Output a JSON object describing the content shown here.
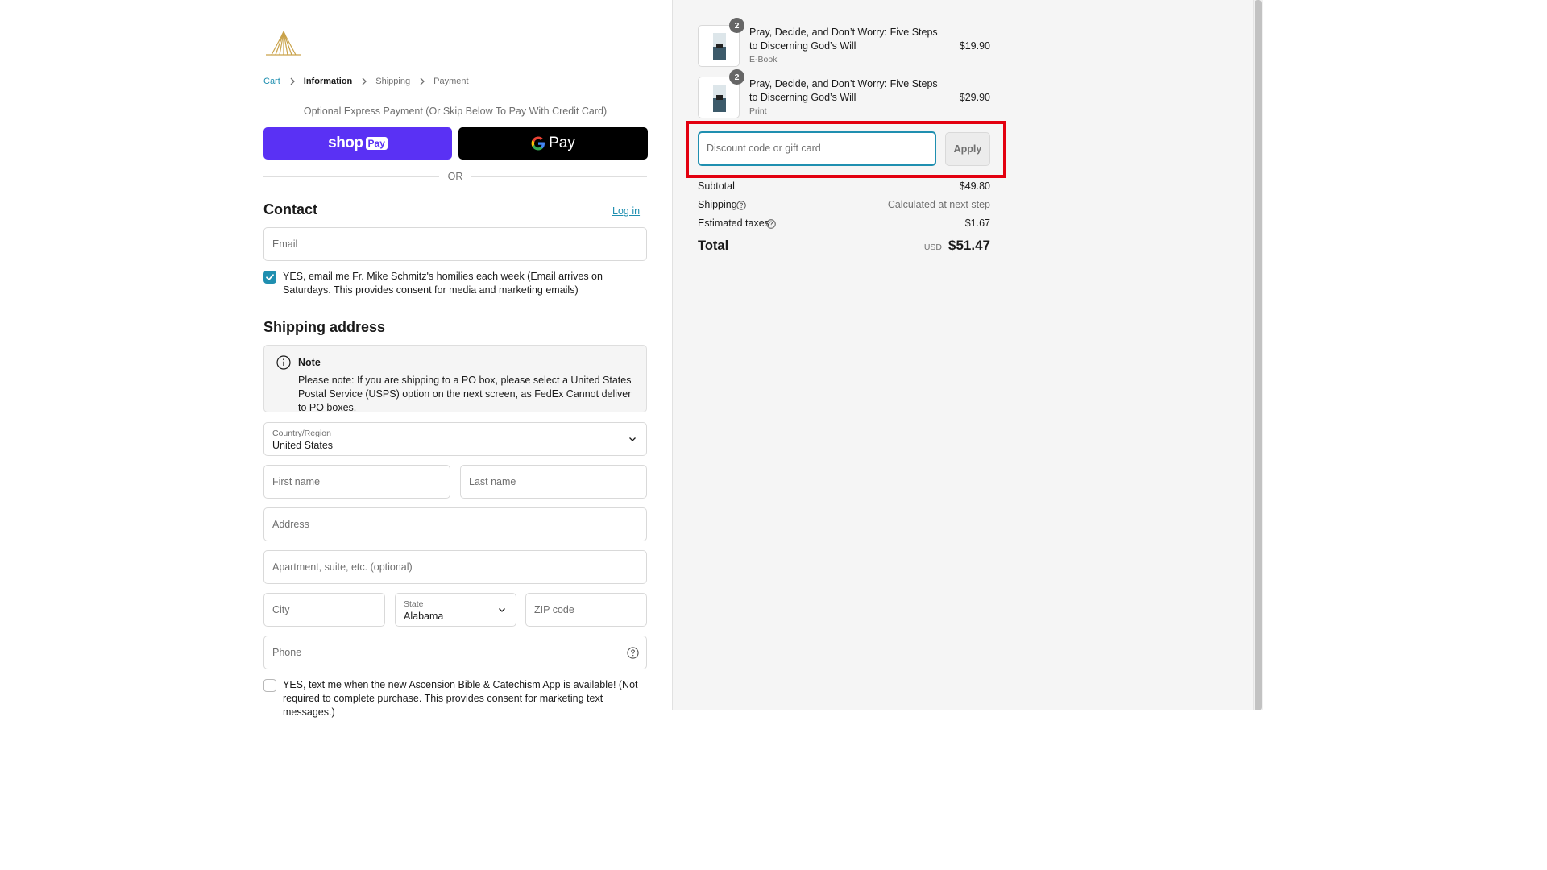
{
  "breadcrumb": {
    "items": [
      {
        "label": "Cart",
        "state": "link"
      },
      {
        "label": "Information",
        "state": "current"
      },
      {
        "label": "Shipping",
        "state": "upcoming"
      },
      {
        "label": "Payment",
        "state": "upcoming"
      }
    ]
  },
  "express": {
    "label": "Optional Express Payment (Or Skip Below To Pay With Credit Card)",
    "shop_pay": {
      "text": "shop",
      "badge": "Pay"
    },
    "google_pay": {
      "text": "Pay"
    },
    "or_label": "OR"
  },
  "contact": {
    "heading": "Contact",
    "login_label": "Log in",
    "email_placeholder": "Email",
    "newsletter_checked": true,
    "newsletter_label": "YES, email me Fr. Mike Schmitz's homilies each week (Email arrives on Saturdays. This provides consent for media and marketing emails)"
  },
  "shipping": {
    "heading": "Shipping address",
    "note_title": "Note",
    "note_body": "Please note: If you are shipping to a PO box, please select a United States Postal Service (USPS) option on the next screen, as FedEx Cannot deliver to PO boxes.",
    "country_label": "Country/Region",
    "country_value": "United States",
    "first_name_placeholder": "First name",
    "last_name_placeholder": "Last name",
    "address_placeholder": "Address",
    "apartment_placeholder": "Apartment, suite, etc. (optional)",
    "city_placeholder": "City",
    "state_label": "State",
    "state_value": "Alabama",
    "zip_placeholder": "ZIP code",
    "phone_placeholder": "Phone",
    "sms_checked": false,
    "sms_label": "YES, text me when the new Ascension Bible & Catechism App is available! (Not required to complete purchase. This provides consent for marketing text messages.)"
  },
  "order": {
    "items": [
      {
        "title": "Pray, Decide, and Don’t Worry: Five Steps to Discerning God’s Will",
        "variant": "E-Book",
        "quantity": "2",
        "price": "$19.90"
      },
      {
        "title": "Pray, Decide, and Don’t Worry: Five Steps to Discerning God’s Will",
        "variant": "Print",
        "quantity": "2",
        "price": "$29.90"
      }
    ],
    "discount_placeholder": "Discount code or gift card",
    "apply_label": "Apply",
    "subtotal_label": "Subtotal",
    "subtotal_value": "$49.80",
    "shipping_label": "Shipping",
    "shipping_value": "Calculated at next step",
    "taxes_label": "Estimated taxes",
    "taxes_value": "$1.67",
    "total_label": "Total",
    "total_currency": "USD",
    "total_value": "$51.47"
  },
  "colors": {
    "accent": "#1f8fb0",
    "shop_pay": "#5a31f4",
    "highlight": "#e3000f"
  }
}
